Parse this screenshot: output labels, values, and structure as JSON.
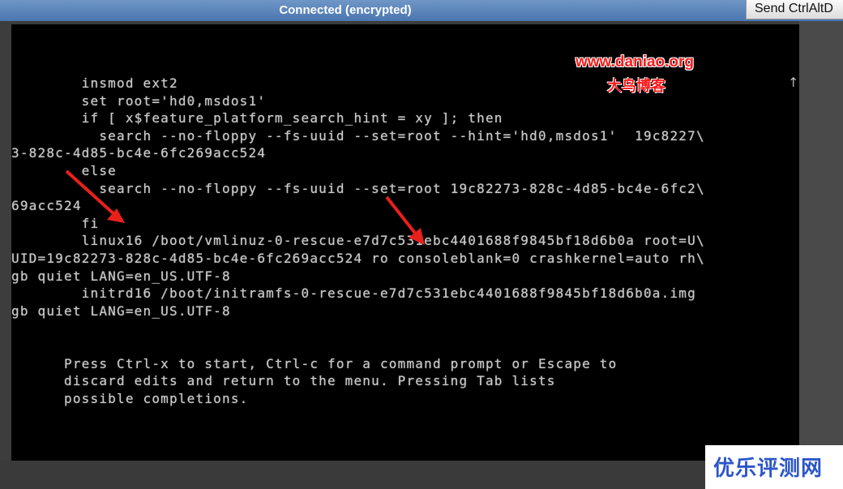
{
  "topbar": {
    "status": "Connected (encrypted)",
    "send_cad_label": "Send CtrlAltD"
  },
  "console": {
    "lines": [
      "        insmod ext2",
      "        set root='hd0,msdos1'",
      "        if [ x$feature_platform_search_hint = xy ]; then",
      "          search --no-floppy --fs-uuid --set=root --hint='hd0,msdos1'  19c8227\\",
      "3-828c-4d85-bc4e-6fc269acc524",
      "        else",
      "          search --no-floppy --fs-uuid --set=root 19c82273-828c-4d85-bc4e-6fc2\\",
      "69acc524",
      "        fi",
      "        linux16 /boot/vmlinuz-0-rescue-e7d7c531ebc4401688f9845bf18d6b0a root=U\\",
      "UID=19c82273-828c-4d85-bc4e-6fc269acc524 ro consoleblank=0 crashkernel=auto rh\\",
      "gb quiet LANG=en_US.UTF-8",
      "        initrd16 /boot/initramfs-0-rescue-e7d7c531ebc4401688f9845bf18d6b0a.img",
      "gb quiet LANG=en_US.UTF-8",
      "",
      "",
      "",
      "      Press Ctrl-x to start, Ctrl-c for a command prompt or Escape to",
      "      discard edits and return to the menu. Pressing Tab lists",
      "      possible completions."
    ],
    "scroll_indicator": "↑"
  },
  "watermark": {
    "url": "www.daniao.org",
    "name": "大鸟博客"
  },
  "corner_badge": {
    "text": "优乐评测网"
  },
  "colors": {
    "arrow": "#e8201c",
    "console_text": "#c8c8c8",
    "badge_text": "#2b56c9"
  }
}
